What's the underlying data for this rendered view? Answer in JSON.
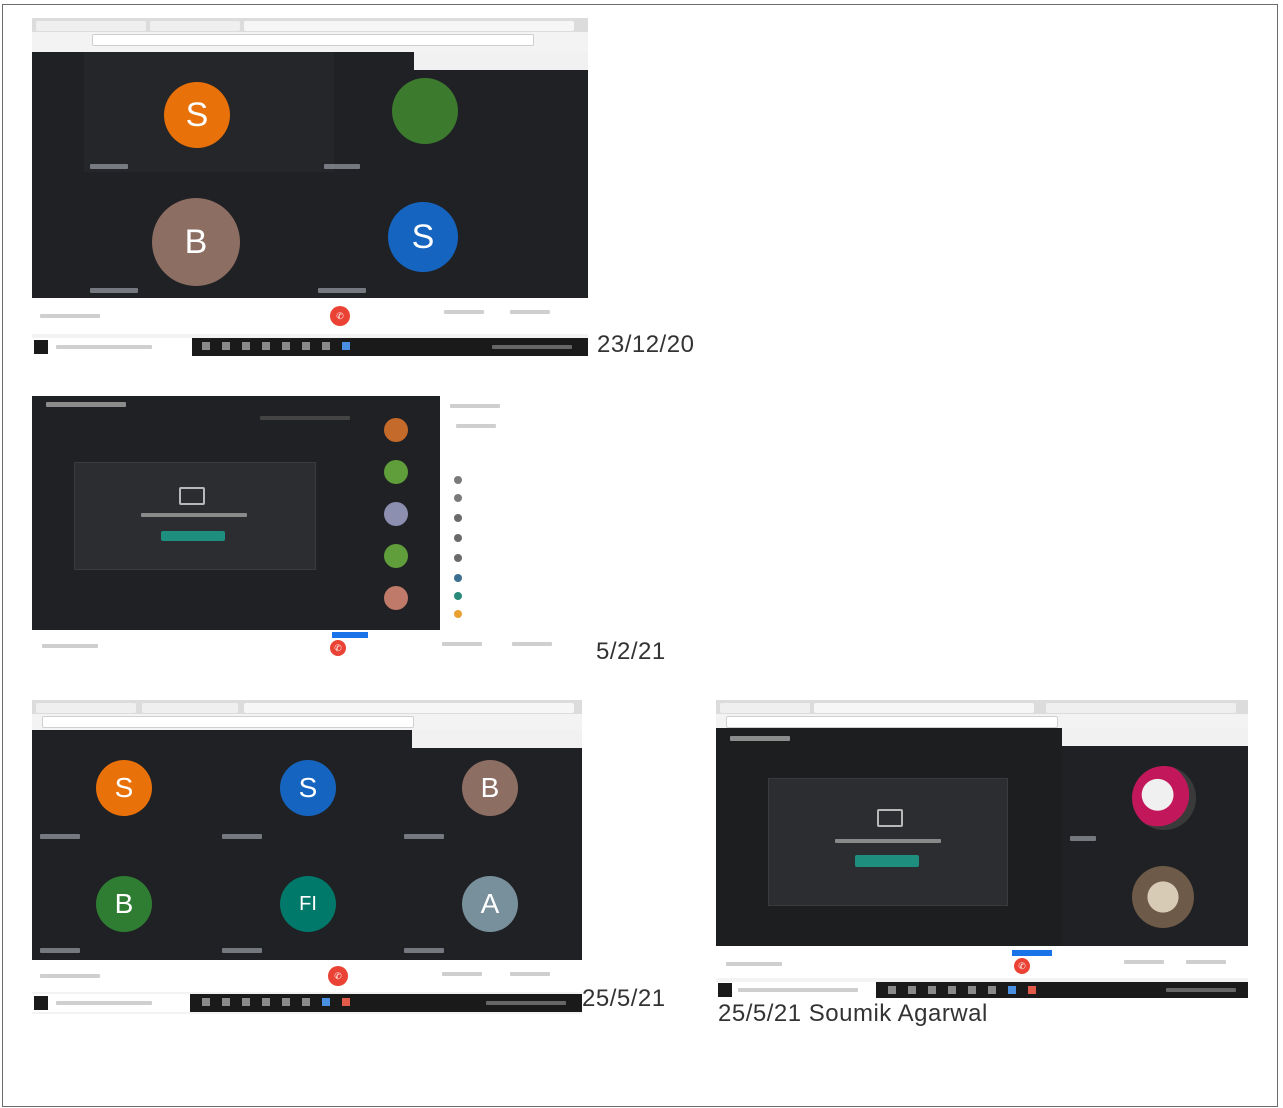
{
  "captions": {
    "shot1": "23/12/20",
    "shot2": "5/2/21",
    "shot3": "25/5/21",
    "shot4": "25/5/21 Soumik Agarwal"
  },
  "shot1": {
    "avatars": [
      {
        "letter": "S",
        "color": "#e8710a"
      },
      {
        "letter": "",
        "color": "#3c7a2e"
      },
      {
        "letter": "B",
        "color": "#8d6e63"
      },
      {
        "letter": "S",
        "color": "#1565c0"
      }
    ]
  },
  "shot3": {
    "avatars": [
      {
        "letter": "S",
        "color": "#e8710a"
      },
      {
        "letter": "S",
        "color": "#1565c0"
      },
      {
        "letter": "B",
        "color": "#8d6e63"
      },
      {
        "letter": "B",
        "color": "#2e7d32"
      },
      {
        "letter": "FI",
        "color": "#00796b"
      },
      {
        "letter": "A",
        "color": "#78909c"
      }
    ]
  },
  "colors": {
    "meet_bg": "#202124",
    "end_call": "#ea4335",
    "present_button": "#1e8e7e"
  },
  "icons": [
    "present-screen-icon",
    "end-call-icon",
    "windows-start-icon"
  ]
}
